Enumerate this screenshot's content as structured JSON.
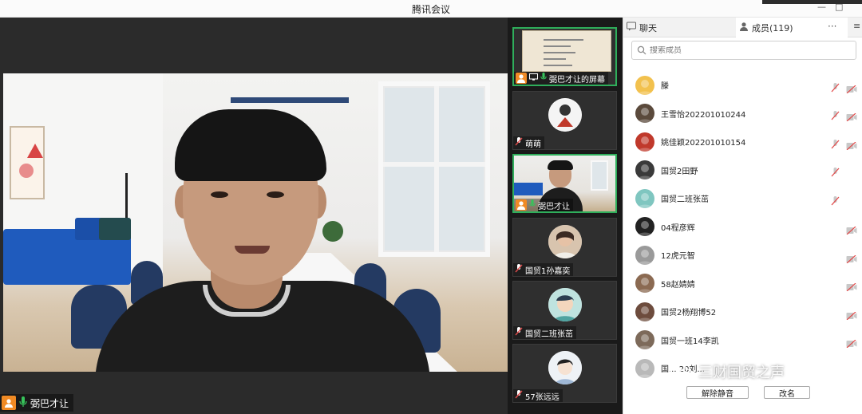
{
  "window": {
    "title": "腾讯会议",
    "min": "—",
    "max": "□"
  },
  "main_video": {
    "speaker_name": "弼巴才让"
  },
  "thumbnails": [
    {
      "name": "弼巴才让的屏幕",
      "kind": "screen",
      "active": true
    },
    {
      "name": "萌萌",
      "kind": "avatar",
      "active": false
    },
    {
      "name": "弼巴才让",
      "kind": "camera",
      "active": true
    },
    {
      "name": "国贸1孙嘉奕",
      "kind": "avatar",
      "active": false
    },
    {
      "name": "国贸二班张茁",
      "kind": "avatar",
      "active": false
    },
    {
      "name": "57张远远",
      "kind": "avatar",
      "active": false
    }
  ],
  "panel": {
    "tab_chat": "聊天",
    "tab_members": "成员(119)",
    "more": "···",
    "search_placeholder": "搜索成员",
    "members": [
      {
        "name": "滕",
        "muted": true,
        "cam_off": true,
        "avatar_color": "#f2c14e"
      },
      {
        "name": "王雪怡202201010244",
        "muted": true,
        "cam_off": true,
        "avatar_color": "#5b4a3c"
      },
      {
        "name": "姚佳颖202201010154",
        "muted": true,
        "cam_off": true,
        "avatar_color": "#c0392b"
      },
      {
        "name": "国贸2田野",
        "muted": true,
        "cam_off": false,
        "avatar_color": "#3a3a3a"
      },
      {
        "name": "国贸二班张茁",
        "muted": true,
        "cam_off": false,
        "avatar_color": "#7fc6c0"
      },
      {
        "name": "04程彦辉",
        "muted": false,
        "cam_off": true,
        "avatar_color": "#222222"
      },
      {
        "name": "12虎元智",
        "muted": false,
        "cam_off": true,
        "avatar_color": "#9a9a9a"
      },
      {
        "name": "58赵婧婧",
        "muted": false,
        "cam_off": true,
        "avatar_color": "#8b6a52"
      },
      {
        "name": "国贸2杨翔博52",
        "muted": false,
        "cam_off": true,
        "avatar_color": "#6d4c3d"
      },
      {
        "name": "国贸一班14李凯",
        "muted": false,
        "cam_off": true,
        "avatar_color": "#7d6a5a"
      },
      {
        "name": "国... 20刘...",
        "muted": false,
        "cam_off": false,
        "avatar_color": "#b9b9b9"
      }
    ],
    "btn_unmute": "解除静音",
    "btn_rename": "改名"
  },
  "watermark": "三财国贸之声"
}
